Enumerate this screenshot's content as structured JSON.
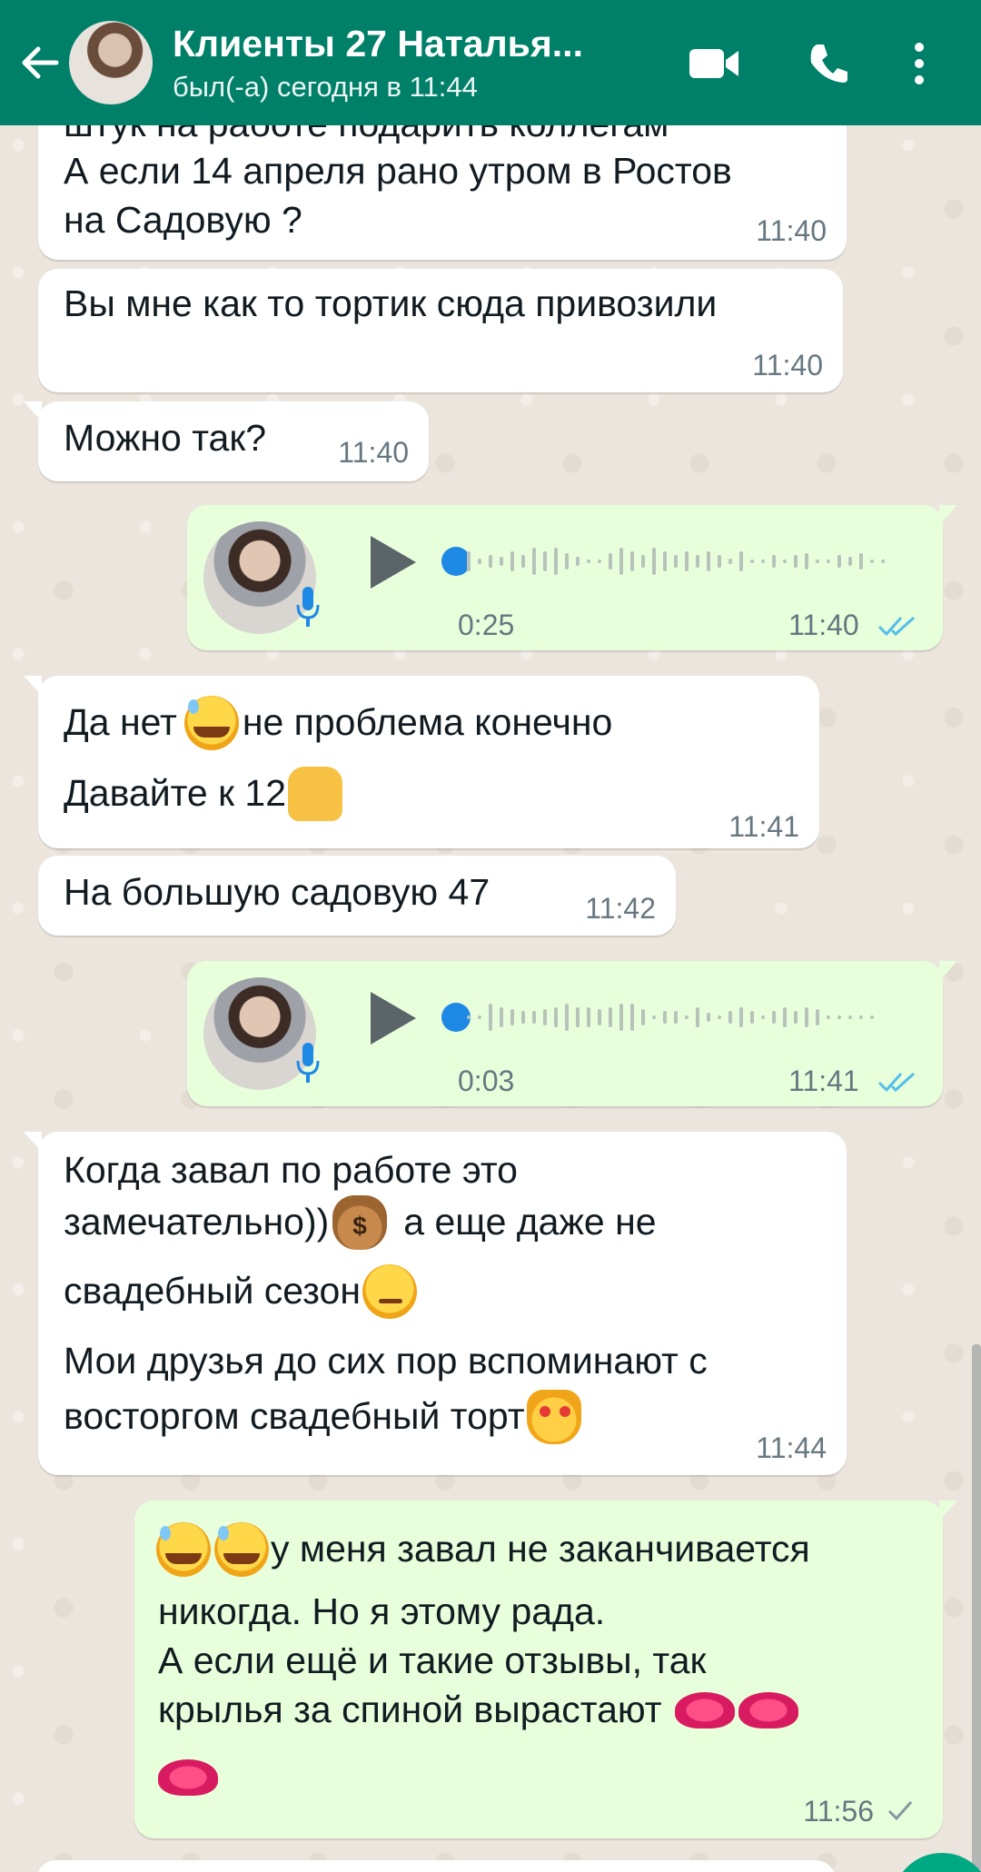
{
  "header": {
    "title": "Клиенты 27 Наталья...",
    "status": "был(-а) сегодня в 11:44"
  },
  "messages": {
    "m1": {
      "line1": "штук на работе подарить коллегам",
      "line2": "А если 14 апреля рано утром в Ростов",
      "line3": "на Садовую ?",
      "time": "11:40"
    },
    "m2": {
      "text": "Вы мне как то тортик сюда привозили",
      "time": "11:40"
    },
    "m3": {
      "text": "Можно так?",
      "time": "11:40"
    },
    "v1": {
      "duration": "0:25",
      "time": "11:40"
    },
    "m4": {
      "line1": "Да нет",
      "line1b": "не проблема конечно",
      "line2": "Давайте к 12",
      "time": "11:41"
    },
    "m5": {
      "text": "На большую садовую 47",
      "time": "11:42"
    },
    "v2": {
      "duration": "0:03",
      "time": "11:41"
    },
    "m6": {
      "line1": "Когда завал по работе это",
      "line2a": "замечательно))",
      "line2b": "а еще даже не",
      "line3": "свадебный сезон",
      "line4": "Мои друзья до сих пор вспоминают с",
      "line5": "восторгом свадебный торт",
      "time": "11:44"
    },
    "m7": {
      "line1": "у меня завал не заканчивается",
      "line2": "никогда. Но я этому рада.",
      "line3": "А если ещё и такие отзывы, так",
      "line4": "крылья за спиной вырастают",
      "time": "11:56"
    }
  },
  "colors": {
    "header": "#008069",
    "outgoing": "#e7ffdb",
    "incoming": "#ffffff",
    "read_ticks": "#53bdeb"
  },
  "icons": [
    "back-arrow-icon",
    "video-call-icon",
    "phone-icon",
    "more-options-icon",
    "play-icon",
    "mic-icon",
    "double-check-icon",
    "single-check-icon"
  ]
}
